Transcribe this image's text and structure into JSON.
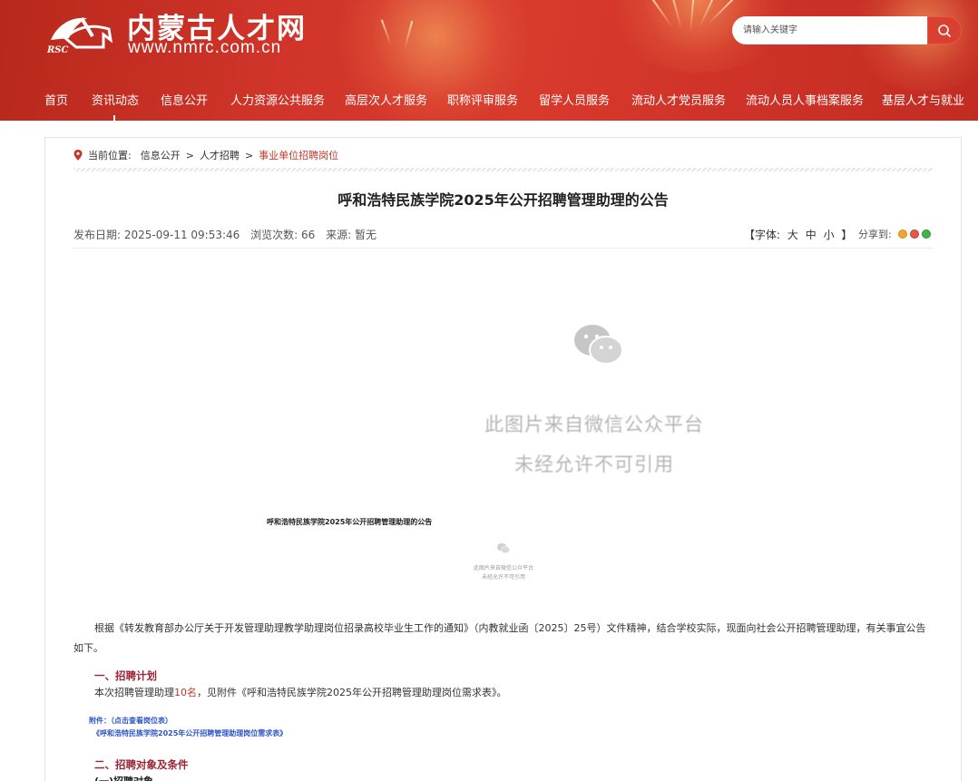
{
  "header": {
    "site_title": "内蒙古人才网",
    "site_url": "www.nmrc.com.cn",
    "logo_text": "RSC",
    "search_placeholder": "请输入关键字",
    "colors": {
      "primary": "#d1352a",
      "accent": "#9b2536"
    }
  },
  "nav": [
    {
      "label": "首页"
    },
    {
      "label": "资讯动态"
    },
    {
      "label": "信息公开"
    },
    {
      "label": "人力资源公共服务"
    },
    {
      "label": "高层次人才服务"
    },
    {
      "label": "职称评审服务"
    },
    {
      "label": "留学人员服务"
    },
    {
      "label": "流动人才党员服务"
    },
    {
      "label": "流动人员人事档案服务"
    },
    {
      "label": "基层人才与就业"
    }
  ],
  "breadcrumb": {
    "prefix": "当前位置:",
    "items": [
      "信息公开",
      "人才招聘",
      "事业单位招聘岗位"
    ],
    "separator": ">"
  },
  "article": {
    "title": "呼和浩特民族学院2025年公开招聘管理助理的公告",
    "publish_date": "发布日期: 2025-09-11 09:53:46",
    "views": "浏览次数: 66",
    "source": "来源: 暂无",
    "font_label": "【字体:",
    "font_large": "大",
    "font_medium": "中",
    "font_small": "小",
    "font_close": "】",
    "share_label": "分享到:",
    "placeholder_line1": "此图片来自微信公众平台",
    "placeholder_line2": "未经允许不可引用",
    "inner_title": "呼和浩特民族学院2025年公开招聘管理助理的公告",
    "paragraph": "根据《转发教育部办公厅关于开发管理助理教学助理岗位招录高校毕业生工作的通知》（内教就业函〔2025〕25号）文件精神，结合学校实际，现面向社会公开招聘管理助理，有关事宜公告如下。",
    "section1": "一、招聘计划",
    "plan_before": "本次招聘管理助理",
    "plan_count": "10名",
    "plan_after": "，见附件《呼和浩特民族学院2025年公开招聘管理助理岗位需求表》。",
    "attachment_label": "附件：（点击查看岗位表）",
    "attachment_link": "《呼和浩特民族学院2025年公开招聘管理助理岗位需求表》",
    "section2": "二、招聘对象及条件",
    "subsection": "(一)招聘对象"
  }
}
